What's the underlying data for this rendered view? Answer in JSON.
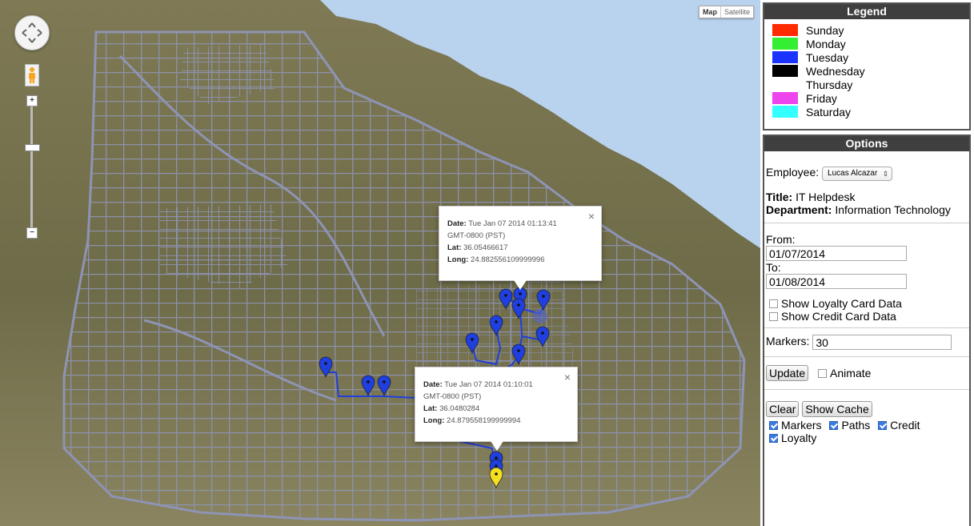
{
  "map": {
    "type_control": {
      "map_label": "Map",
      "satellite_label": "Satellite",
      "active": "map"
    },
    "zoom_in_label": "+",
    "zoom_out_label": "−",
    "route_color": "#1f3fe0",
    "marker_color": "#1f3fe0",
    "current_marker_color": "#f5e020",
    "infowindows": [
      {
        "date_label": "Date:",
        "date": "Tue Jan 07 2014 01:13:41",
        "tz": "GMT-0800 (PST)",
        "lat_label": "Lat:",
        "lat": "36.05466617",
        "long_label": "Long:",
        "long": "24.882556109999996"
      },
      {
        "date_label": "Date:",
        "date": "Tue Jan 07 2014 01:10:01",
        "tz": "GMT-0800 (PST)",
        "lat_label": "Lat:",
        "lat": "36.0480284",
        "long_label": "Long:",
        "long": "24.879558199999994"
      }
    ]
  },
  "legend": {
    "title": "Legend",
    "items": [
      {
        "label": "Sunday",
        "color": "#ff2a00"
      },
      {
        "label": "Monday",
        "color": "#33ee33"
      },
      {
        "label": "Tuesday",
        "color": "#1a33ff"
      },
      {
        "label": "Wednesday",
        "color": "#000000"
      },
      {
        "label": "Thursday",
        "color": "#ffffff"
      },
      {
        "label": "Friday",
        "color": "#ee44ee"
      },
      {
        "label": "Saturday",
        "color": "#33ffff"
      }
    ]
  },
  "options": {
    "title": "Options",
    "employee_label": "Employee:",
    "employee_value": "Lucas Alcazar",
    "title_label": "Title:",
    "title_value": "IT Helpdesk",
    "department_label": "Department:",
    "department_value": "Information Technology",
    "from_label": "From:",
    "from_value": "01/07/2014",
    "to_label": "To:",
    "to_value": "01/08/2014",
    "show_loyalty_label": "Show Loyalty Card Data",
    "show_credit_label": "Show Credit Card Data",
    "markers_label": "Markers:",
    "markers_value": "30",
    "update_label": "Update",
    "animate_label": "Animate",
    "clear_label": "Clear",
    "show_cache_label": "Show Cache",
    "markers_check_label": "Markers",
    "paths_check_label": "Paths",
    "credit_check_label": "Credit",
    "loyalty_check_label": "Loyalty"
  }
}
